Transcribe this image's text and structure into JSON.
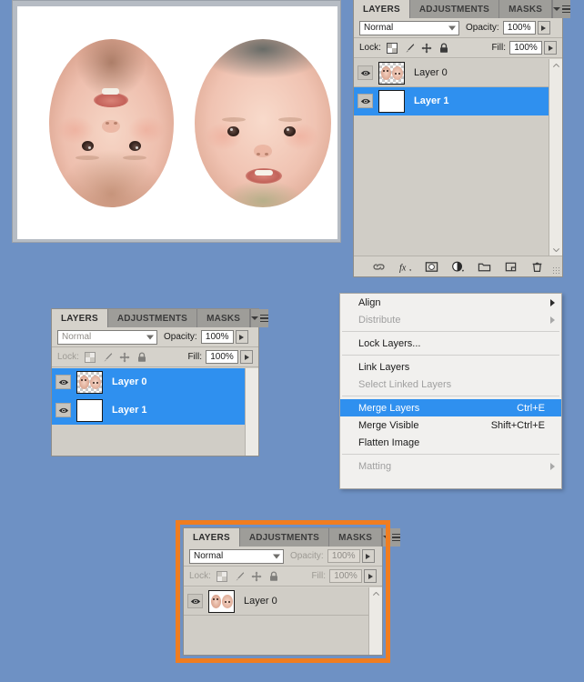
{
  "app": {
    "name": "Adobe Photoshop Layers Panel",
    "background_color": "#6e91c4",
    "accent_selected": "#2f90ef",
    "highlight_frame_color": "#f07d20"
  },
  "document_window": {
    "canvas_background": "#ffffff",
    "content_description": "Two cropped baby face cutouts on a white canvas; left face is rotated 180 degrees"
  },
  "panels": {
    "top": {
      "tabs": [
        {
          "label": "LAYERS",
          "active": true
        },
        {
          "label": "ADJUSTMENTS",
          "active": false
        },
        {
          "label": "MASKS",
          "active": false
        }
      ],
      "panel_menu_icon": "panel-menu-icon",
      "blend_mode": "Normal",
      "opacity_label": "Opacity:",
      "opacity_value": "100%",
      "lock_label": "Lock:",
      "lock_icons": [
        "lock-transparency-icon",
        "lock-image-pixels-icon",
        "lock-position-icon",
        "lock-all-icon"
      ],
      "fill_label": "Fill:",
      "fill_value": "100%",
      "disabled": false,
      "layers": [
        {
          "name": "Layer 0",
          "visible": true,
          "selected": false,
          "thumb": "faces"
        },
        {
          "name": "Layer 1",
          "visible": true,
          "selected": true,
          "thumb": "white"
        }
      ],
      "toolbar_icons": [
        "link-layers-icon",
        "layer-style-fx-icon",
        "add-layer-mask-icon",
        "new-adjustment-layer-icon",
        "new-group-icon",
        "new-layer-icon",
        "delete-layer-icon"
      ]
    },
    "middle": {
      "tabs": [
        {
          "label": "LAYERS",
          "active": true
        },
        {
          "label": "ADJUSTMENTS",
          "active": false
        },
        {
          "label": "MASKS",
          "active": false
        }
      ],
      "panel_menu_icon": "panel-menu-icon",
      "blend_mode": "Normal",
      "opacity_label": "Opacity:",
      "opacity_value": "100%",
      "lock_label": "Lock:",
      "fill_label": "Fill:",
      "fill_value": "100%",
      "disabled": true,
      "layers": [
        {
          "name": "Layer 0",
          "visible": true,
          "selected": true,
          "thumb": "faces"
        },
        {
          "name": "Layer 1",
          "visible": true,
          "selected": true,
          "thumb": "white"
        }
      ]
    },
    "bottom": {
      "tabs": [
        {
          "label": "LAYERS",
          "active": true
        },
        {
          "label": "ADJUSTMENTS",
          "active": false
        },
        {
          "label": "MASKS",
          "active": false
        }
      ],
      "panel_menu_icon": "panel-menu-icon",
      "blend_mode": "Normal",
      "opacity_label": "Opacity:",
      "opacity_value": "100%",
      "lock_label": "Lock:",
      "fill_label": "Fill:",
      "fill_value": "100%",
      "disabled": true,
      "highlighted": true,
      "layers": [
        {
          "name": "Layer 0",
          "visible": true,
          "selected": false,
          "thumb": "faces-merged"
        }
      ]
    }
  },
  "context_menu": {
    "items": [
      {
        "label": "Align",
        "accel": "",
        "disabled": false,
        "submenu": true,
        "highlight": false
      },
      {
        "label": "Distribute",
        "accel": "",
        "disabled": true,
        "submenu": true,
        "highlight": false
      },
      {
        "separator": true
      },
      {
        "label": "Lock Layers...",
        "accel": "",
        "disabled": false,
        "submenu": false,
        "highlight": false
      },
      {
        "separator": true
      },
      {
        "label": "Link Layers",
        "accel": "",
        "disabled": false,
        "submenu": false,
        "highlight": false
      },
      {
        "label": "Select Linked Layers",
        "accel": "",
        "disabled": true,
        "submenu": false,
        "highlight": false
      },
      {
        "separator": true
      },
      {
        "label": "Merge Layers",
        "accel": "Ctrl+E",
        "disabled": false,
        "submenu": false,
        "highlight": true
      },
      {
        "label": "Merge Visible",
        "accel": "Shift+Ctrl+E",
        "disabled": false,
        "submenu": false,
        "highlight": false
      },
      {
        "label": "Flatten Image",
        "accel": "",
        "disabled": false,
        "submenu": false,
        "highlight": false
      },
      {
        "separator": true
      },
      {
        "label": "Matting",
        "accel": "",
        "disabled": true,
        "submenu": true,
        "highlight": false
      }
    ]
  }
}
